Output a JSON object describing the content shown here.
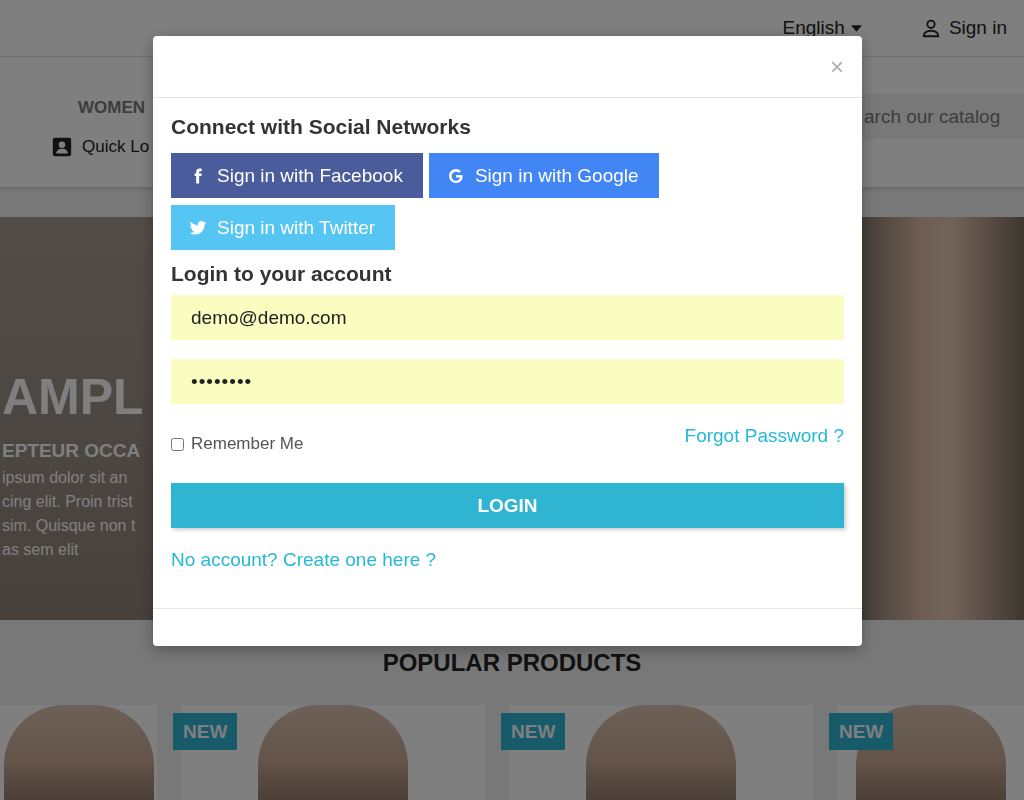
{
  "page": {
    "topbar": {
      "language": "English",
      "sign_in": "Sign in"
    },
    "nav": {
      "menu": [
        {
          "label": "WOMEN"
        }
      ],
      "quick_link": "Quick Lo",
      "search": {
        "placeholder": "arch our catalog"
      }
    },
    "hero": {
      "title": "AMPL",
      "subtitle": "EPTEUR OCCA",
      "lines": [
        "ipsum dolor sit an",
        "cing elit. Proin trist",
        "sim. Quisque non t",
        "as sem elit"
      ]
    },
    "products": {
      "title": "POPULAR PRODUCTS",
      "items": [
        {
          "flag": null
        },
        {
          "flag": "NEW"
        },
        {
          "flag": "NEW"
        },
        {
          "flag": "NEW"
        }
      ]
    }
  },
  "modal": {
    "close": "×",
    "social": {
      "title": "Connect with Social Networks",
      "buttons": [
        {
          "kind": "facebook",
          "label": "Sign in with Facebook",
          "color": "#4a5c9b"
        },
        {
          "kind": "google",
          "label": "Sign in with Google",
          "color": "#4285f4"
        },
        {
          "kind": "twitter",
          "label": "Sign in with Twitter",
          "color": "#55c6f4"
        }
      ]
    },
    "login": {
      "title": "Login to your account",
      "email": "demo@demo.com",
      "password": "••••••••",
      "remember": {
        "label": "Remember Me",
        "checked": false
      },
      "forgot": "Forgot Password ?",
      "submit": "LOGIN",
      "create_account": "No account? Create one here ?"
    }
  }
}
